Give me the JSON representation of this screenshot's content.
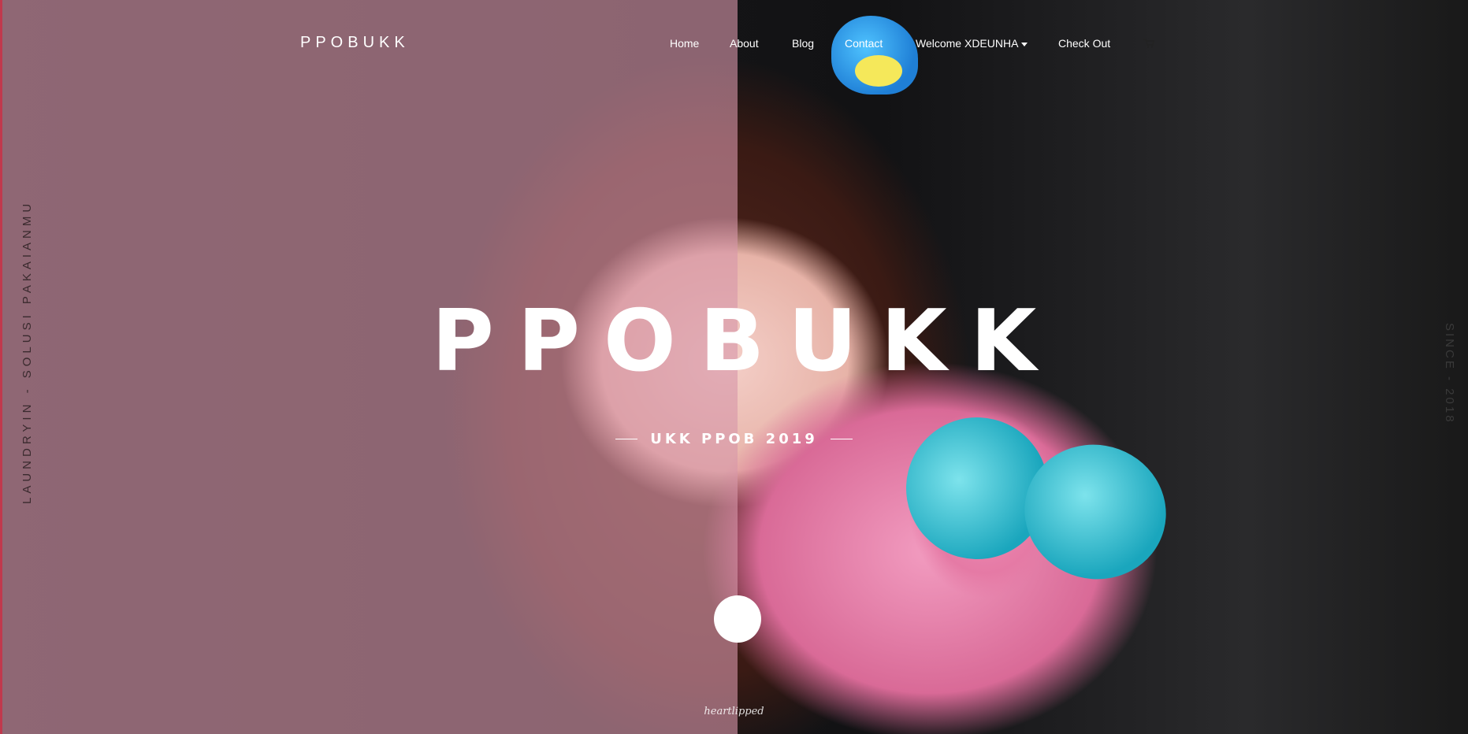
{
  "nav": {
    "brand": "PPOBUKK",
    "items": [
      {
        "label": "Home"
      },
      {
        "label": "About"
      },
      {
        "label": "Blog"
      },
      {
        "label": "Contact"
      },
      {
        "label": "Welcome XDEUNHA"
      },
      {
        "label": "Check Out"
      }
    ],
    "cart_icon": "cart-icon"
  },
  "hero": {
    "title": "PPOBUKK",
    "subtitle": "UKK PPOB 2019",
    "side_left": "LAUNDRYIN - SOLUSI PAKAIANMU",
    "side_right": "SINCE - 2018",
    "watermark": "heartlipped"
  },
  "colors": {
    "tint": "#d696aa",
    "accent_edge": "#c0394d",
    "text": "#ffffff"
  }
}
